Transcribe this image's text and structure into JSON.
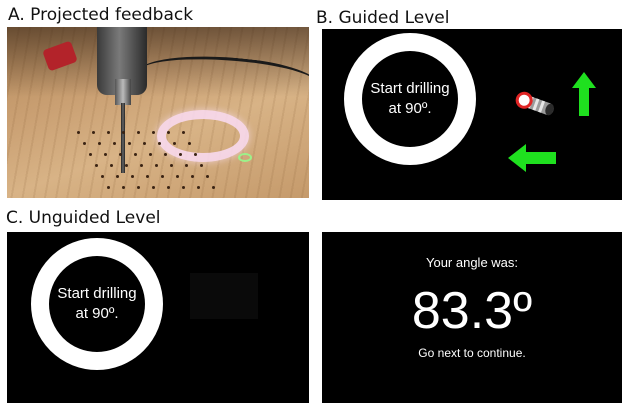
{
  "panels": {
    "a": {
      "label": "A. Projected feedback"
    },
    "b": {
      "label": "B. Guided Level",
      "ring_line1": "Start drilling",
      "ring_line2": "at 90º."
    },
    "c": {
      "label": "C. Unguided Level",
      "ring_line1": "Start drilling",
      "ring_line2": "at 90º."
    },
    "d": {
      "title": "Your angle was:",
      "angle_value": "83.3º",
      "next_hint": "Go next to continue."
    }
  },
  "colors": {
    "screen_bg": "#000000",
    "ring": "#ffffff",
    "arrow_green": "#1fe01f",
    "tracker_red": "#e02525"
  },
  "icons": [
    "drill-photo",
    "projected-ring",
    "up-arrow-icon",
    "left-arrow-icon",
    "drill-marker-icon"
  ]
}
